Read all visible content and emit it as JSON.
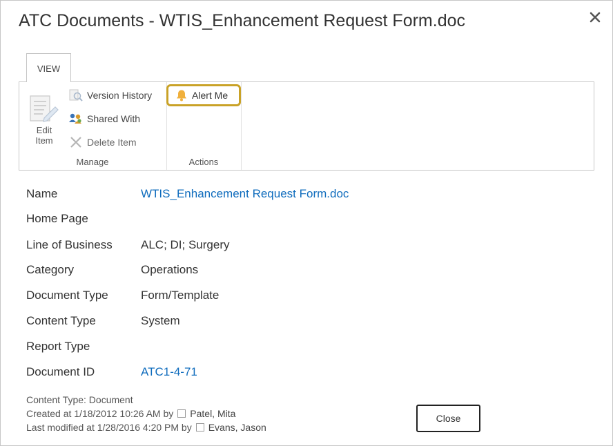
{
  "dialog": {
    "title": "ATC Documents - WTIS_Enhancement Request Form.doc"
  },
  "ribbon": {
    "tab_label": "VIEW",
    "manage": {
      "edit_item_line1": "Edit",
      "edit_item_line2": "Item",
      "version_history": "Version History",
      "shared_with": "Shared With",
      "delete_item": "Delete Item",
      "group_label": "Manage"
    },
    "actions": {
      "alert_me": "Alert Me",
      "group_label": "Actions"
    }
  },
  "properties": [
    {
      "label": "Name",
      "value": "WTIS_Enhancement Request Form.doc",
      "link": true
    },
    {
      "label": "Home Page",
      "value": "",
      "link": false
    },
    {
      "label": "Line of Business",
      "value": "ALC; DI; Surgery",
      "link": false
    },
    {
      "label": "Category",
      "value": "Operations",
      "link": false
    },
    {
      "label": "Document Type",
      "value": "Form/Template",
      "link": false
    },
    {
      "label": "Content Type",
      "value": "System",
      "link": false
    },
    {
      "label": "Report Type",
      "value": "",
      "link": false
    },
    {
      "label": "Document ID",
      "value": "ATC1-4-71",
      "link": true
    }
  ],
  "footer": {
    "content_type": "Content Type: Document",
    "created": "Created at 1/18/2012 10:26 AM  by",
    "created_by": "Patel, Mita",
    "modified": "Last modified at 1/28/2016 4:20 PM  by",
    "modified_by": "Evans, Jason",
    "close_label": "Close"
  },
  "colors": {
    "link": "#0f6cbd",
    "alert_highlight": "#c9a227"
  }
}
